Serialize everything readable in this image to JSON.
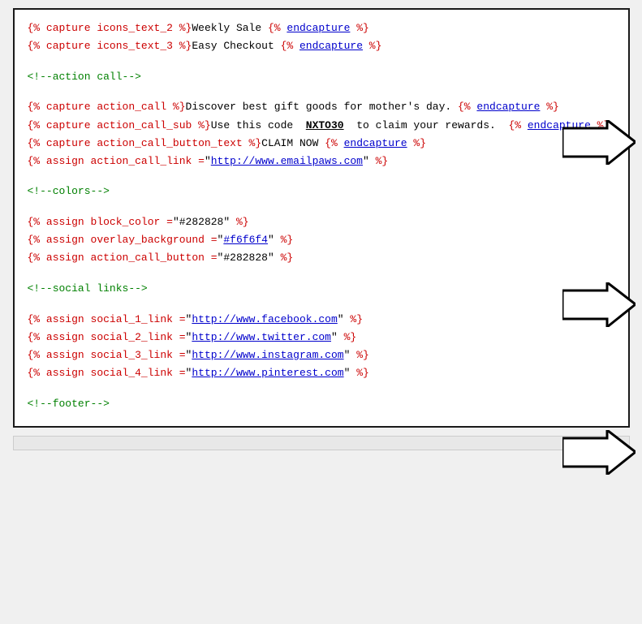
{
  "code": {
    "lines": [
      {
        "id": "l1",
        "type": "code-red",
        "parts": [
          {
            "text": "{% capture icons_text_2 %}",
            "class": "keyword"
          },
          {
            "text": "Weekly Sale",
            "class": "text-black"
          },
          {
            "text": " {% ",
            "class": "keyword"
          },
          {
            "text": "endcapture",
            "class": "link"
          },
          {
            "text": " %}",
            "class": "keyword"
          }
        ]
      },
      {
        "id": "l2",
        "type": "code-red",
        "parts": [
          {
            "text": "{% capture icons_text_3 %}",
            "class": "keyword"
          },
          {
            "text": "Easy Checkout",
            "class": "text-black"
          },
          {
            "text": " {% ",
            "class": "keyword"
          },
          {
            "text": "endcapture",
            "class": "link"
          },
          {
            "text": " %}",
            "class": "keyword"
          }
        ]
      },
      {
        "id": "lb1",
        "type": "blank"
      },
      {
        "id": "c1",
        "type": "comment",
        "text": "<!--action call-->"
      },
      {
        "id": "lb2",
        "type": "blank"
      },
      {
        "id": "l3",
        "type": "code-red",
        "parts": [
          {
            "text": "{% capture action_call %}",
            "class": "keyword"
          },
          {
            "text": "Discover best gift goods for mother's day.",
            "class": "text-black"
          },
          {
            "text": " {% ",
            "class": "keyword"
          },
          {
            "text": "endcapture",
            "class": "link"
          },
          {
            "text": " %}",
            "class": "keyword"
          }
        ]
      },
      {
        "id": "l4",
        "type": "code-red",
        "parts": [
          {
            "text": "{% capture action_call_sub %}",
            "class": "keyword"
          },
          {
            "text": "Use this code <strong> <u>NXTO30</u> </strong> to claim your rewards.",
            "class": "text-black"
          },
          {
            "text": "  {% ",
            "class": "keyword"
          },
          {
            "text": "endcapture",
            "class": "link"
          },
          {
            "text": " %}",
            "class": "keyword"
          }
        ]
      },
      {
        "id": "l5",
        "type": "code-red",
        "parts": [
          {
            "text": "{% capture action_call_button_text %}",
            "class": "keyword"
          },
          {
            "text": "CLAIM NOW",
            "class": "text-black"
          },
          {
            "text": " {% ",
            "class": "keyword"
          },
          {
            "text": "endcapture",
            "class": "link"
          },
          {
            "text": " %}",
            "class": "keyword"
          }
        ]
      },
      {
        "id": "l6",
        "type": "code-red",
        "parts": [
          {
            "text": "{% assign action_call_link =",
            "class": "keyword"
          },
          {
            "text": "\"",
            "class": "text-black"
          },
          {
            "text": "http://www.emailpaws.com",
            "class": "link"
          },
          {
            "text": "\"",
            "class": "text-black"
          },
          {
            "text": " %}",
            "class": "keyword"
          }
        ]
      },
      {
        "id": "lb3",
        "type": "blank"
      },
      {
        "id": "c2",
        "type": "comment",
        "text": "<!--colors-->"
      },
      {
        "id": "lb4",
        "type": "blank"
      },
      {
        "id": "l7",
        "type": "code-red",
        "parts": [
          {
            "text": "{% assign block_color =",
            "class": "keyword"
          },
          {
            "text": "\"#282828\"",
            "class": "text-black"
          },
          {
            "text": " %}",
            "class": "keyword"
          }
        ]
      },
      {
        "id": "l8",
        "type": "code-red",
        "parts": [
          {
            "text": "{% assign overlay_background =",
            "class": "keyword"
          },
          {
            "text": "\"",
            "class": "text-black"
          },
          {
            "text": "#f6f6f4",
            "class": "link"
          },
          {
            "text": "\"",
            "class": "text-black"
          },
          {
            "text": " %}",
            "class": "keyword"
          }
        ]
      },
      {
        "id": "l9",
        "type": "code-red",
        "parts": [
          {
            "text": "{% assign action_call_button =",
            "class": "keyword"
          },
          {
            "text": "\"#282828\"",
            "class": "text-black"
          },
          {
            "text": " %}",
            "class": "keyword"
          }
        ]
      },
      {
        "id": "lb5",
        "type": "blank"
      },
      {
        "id": "c3",
        "type": "comment",
        "text": "<!--social links-->"
      },
      {
        "id": "lb6",
        "type": "blank"
      },
      {
        "id": "l10",
        "type": "code-red",
        "parts": [
          {
            "text": "{% assign social_1_link =",
            "class": "keyword"
          },
          {
            "text": "\"",
            "class": "text-black"
          },
          {
            "text": "http://www.facebook.com",
            "class": "link"
          },
          {
            "text": "\"",
            "class": "text-black"
          },
          {
            "text": " %}",
            "class": "keyword"
          }
        ]
      },
      {
        "id": "l11",
        "type": "code-red",
        "parts": [
          {
            "text": "{% assign social_2_link =",
            "class": "keyword"
          },
          {
            "text": "\"",
            "class": "text-black"
          },
          {
            "text": "http://www.twitter.com",
            "class": "link"
          },
          {
            "text": "\"",
            "class": "text-black"
          },
          {
            "text": " %}",
            "class": "keyword"
          }
        ]
      },
      {
        "id": "l12",
        "type": "code-red",
        "parts": [
          {
            "text": "{% assign social_3_link =",
            "class": "keyword"
          },
          {
            "text": "\"",
            "class": "text-black"
          },
          {
            "text": "http://www.instagram.com",
            "class": "link"
          },
          {
            "text": "\"",
            "class": "text-black"
          },
          {
            "text": " %}",
            "class": "keyword"
          }
        ]
      },
      {
        "id": "l13",
        "type": "code-red",
        "parts": [
          {
            "text": "{% assign social_4_link =",
            "class": "keyword"
          },
          {
            "text": "\"",
            "class": "text-black"
          },
          {
            "text": "http://www.pinterest.com",
            "class": "link"
          },
          {
            "text": "\"",
            "class": "text-black"
          },
          {
            "text": " %}",
            "class": "keyword"
          }
        ]
      },
      {
        "id": "lb7",
        "type": "blank"
      },
      {
        "id": "c4",
        "type": "comment",
        "text": "<!--footer-->"
      }
    ]
  },
  "arrows": {
    "arrow1_label": "arrow pointing to CLAIM NOW line",
    "arrow2_label": "arrow pointing to colors section",
    "arrow3_label": "arrow pointing to social links section"
  }
}
